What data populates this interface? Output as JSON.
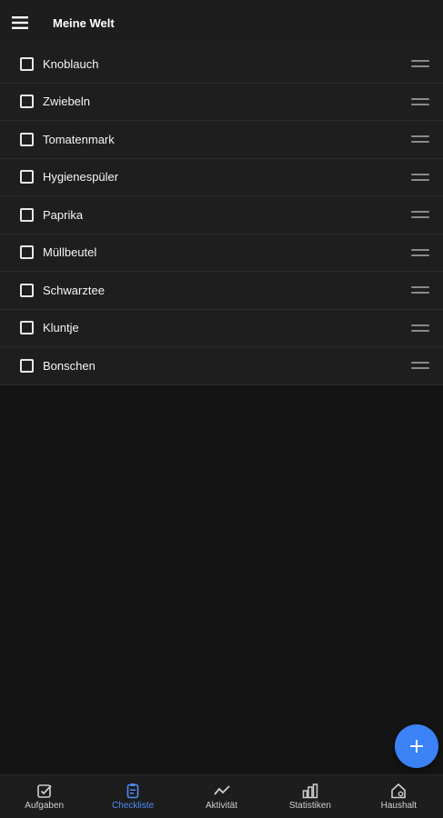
{
  "header": {
    "title": "Meine Welt",
    "menu_icon": "hamburger-menu-icon"
  },
  "checklist": {
    "items": [
      {
        "label": "Knoblauch",
        "checked": false
      },
      {
        "label": "Zwiebeln",
        "checked": false
      },
      {
        "label": "Tomatenmark",
        "checked": false
      },
      {
        "label": "Hygienespüler",
        "checked": false
      },
      {
        "label": "Paprika",
        "checked": false
      },
      {
        "label": "Müllbeutel",
        "checked": false
      },
      {
        "label": "Schwarztee",
        "checked": false
      },
      {
        "label": "Kluntje",
        "checked": false
      },
      {
        "label": "Bonschen",
        "checked": false
      }
    ]
  },
  "fab": {
    "icon": "plus-icon"
  },
  "bottom_nav": {
    "items": [
      {
        "label": "Aufgaben",
        "icon": "checkbox-icon"
      },
      {
        "label": "Checkliste",
        "icon": "clipboard-list-icon",
        "active": true
      },
      {
        "label": "Aktivität",
        "icon": "activity-line-icon"
      },
      {
        "label": "Statistiken",
        "icon": "bar-chart-icon"
      },
      {
        "label": "Haushalt",
        "icon": "home-icon"
      }
    ]
  },
  "colors": {
    "background": "#141414",
    "surface": "#1e1e1e",
    "accent": "#3b82f6",
    "active_nav": "#4d8cf5"
  }
}
